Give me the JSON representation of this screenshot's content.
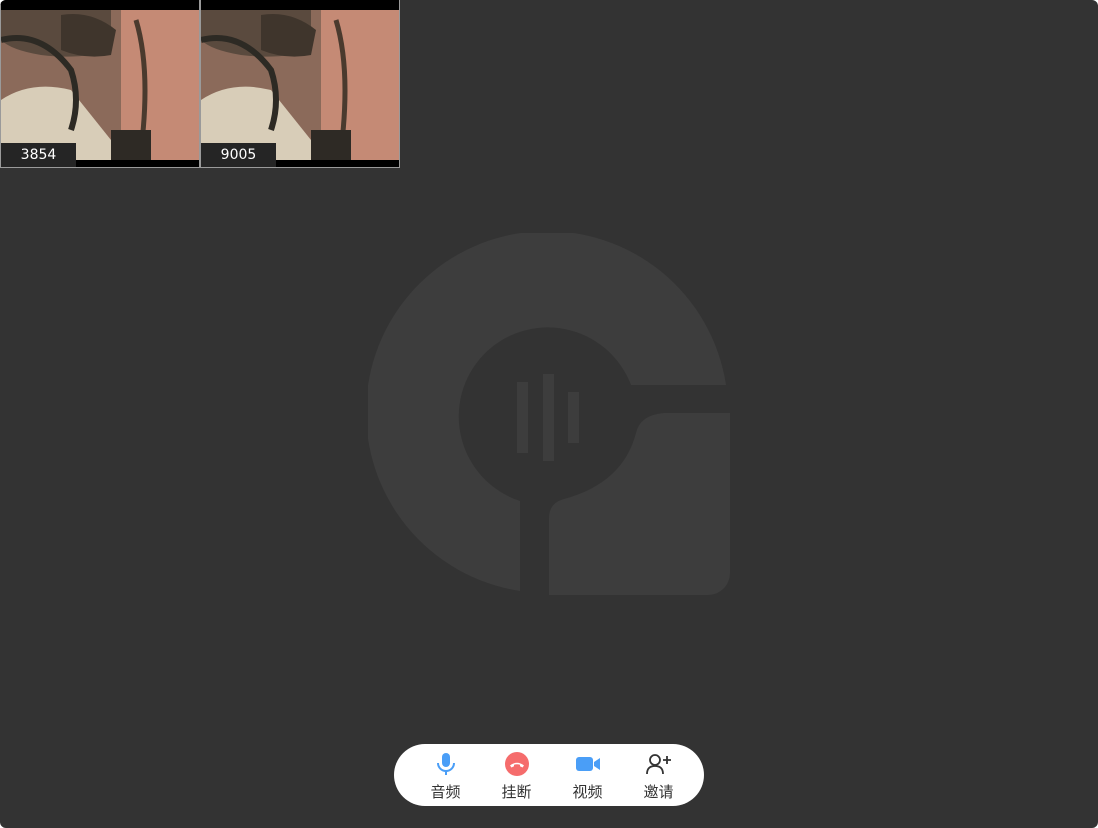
{
  "participants": [
    {
      "id_label": "3854"
    },
    {
      "id_label": "9005"
    }
  ],
  "toolbar": {
    "audio_label": "音频",
    "hangup_label": "挂断",
    "video_label": "视频",
    "invite_label": "邀请"
  },
  "icons": {
    "audio": "microphone-icon",
    "hangup": "phone-hangup-icon",
    "video": "video-camera-icon",
    "invite": "add-user-icon"
  },
  "colors": {
    "background": "#333333",
    "accent_blue": "#4a9ef7",
    "hangup_red": "#f56c6c",
    "logo": "#3d3d3d"
  }
}
